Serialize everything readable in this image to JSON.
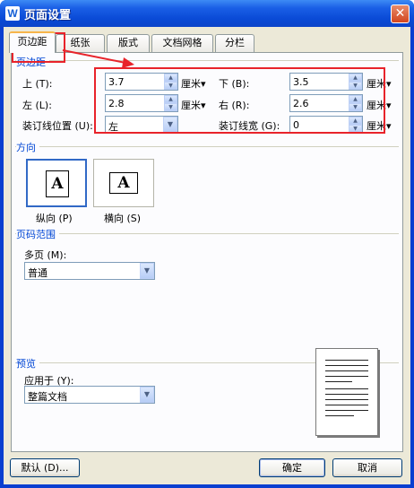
{
  "window": {
    "title": "页面设置",
    "app_icon_letter": "W",
    "close_glyph": "✕"
  },
  "tabs": [
    {
      "label": "页边距",
      "active": true
    },
    {
      "label": "纸张",
      "active": false
    },
    {
      "label": "版式",
      "active": false
    },
    {
      "label": "文档网格",
      "active": false
    },
    {
      "label": "分栏",
      "active": false
    }
  ],
  "margins": {
    "group_title": "页边距",
    "top": {
      "label": "上 (T):",
      "value": "3.7",
      "unit": "厘米▾"
    },
    "bottom": {
      "label": "下 (B):",
      "value": "3.5",
      "unit": "厘米▾"
    },
    "left": {
      "label": "左 (L):",
      "value": "2.8",
      "unit": "厘米▾"
    },
    "right": {
      "label": "右 (R):",
      "value": "2.6",
      "unit": "厘米▾"
    },
    "gutter_position": {
      "label": "装订线位置 (U):",
      "value": "左"
    },
    "gutter_width": {
      "label": "装订线宽 (G):",
      "value": "0",
      "unit": "厘米▾"
    }
  },
  "orientation": {
    "group_title": "方向",
    "portrait_label": "纵向 (P)",
    "landscape_label": "横向 (S)",
    "glyph": "A",
    "selected": "portrait"
  },
  "page_range": {
    "group_title": "页码范围",
    "multiple_pages_label": "多页 (M):",
    "multiple_pages_value": "普通"
  },
  "preview": {
    "group_title": "预览",
    "apply_to_label": "应用于 (Y):",
    "apply_to_value": "整篇文档"
  },
  "buttons": {
    "default_label": "默认 (D)...",
    "ok_label": "确定",
    "cancel_label": "取消"
  },
  "colors": {
    "highlight": "#e8232a",
    "group_title": "#0046d5",
    "titlebar": "#0a4ad6"
  }
}
